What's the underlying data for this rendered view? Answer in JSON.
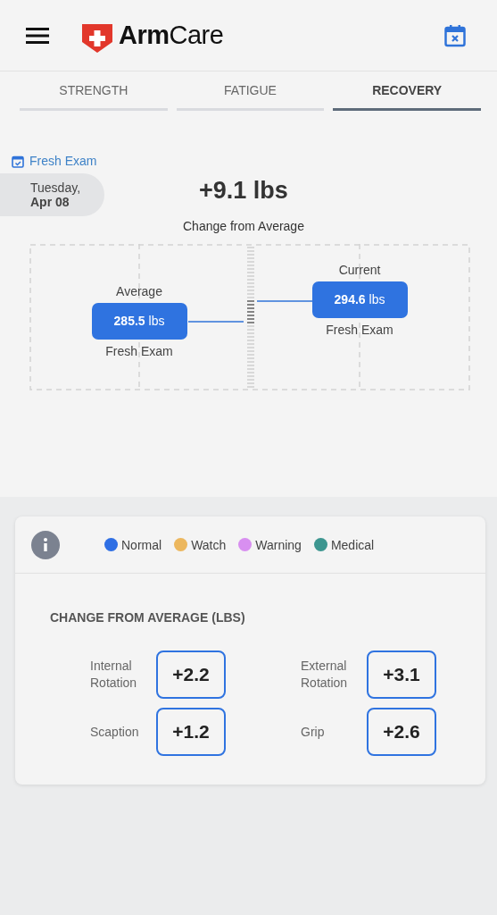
{
  "header": {
    "logo": "**Arm**Care"
  },
  "tabs": [
    {
      "label": "STRENGTH",
      "selected": false
    },
    {
      "label": "FATIGUE",
      "selected": false
    },
    {
      "label": "RECOVERY",
      "selected": true
    }
  ],
  "exam": {
    "type": "Fresh Exam",
    "day": "Tuesday,",
    "date": "Apr 08"
  },
  "change": {
    "value": "+9.1 lbs",
    "caption": "Change from Average"
  },
  "comparison": {
    "average": {
      "title": "Average",
      "value": "**285.5** lbs",
      "source": "Fresh Exam"
    },
    "current": {
      "title": "Current",
      "value": "**294.6** lbs",
      "source": "Fresh Exam"
    }
  },
  "legend": [
    {
      "label": "Normal",
      "color": "#2f6fe4"
    },
    {
      "label": "Watch",
      "color": "#ecb75e"
    },
    {
      "label": "Warning",
      "color": "#d88ff0"
    },
    {
      "label": "Medical",
      "color": "#3d9690"
    }
  ],
  "metrics_title": "CHANGE FROM AVERAGE (LBS)",
  "metrics": [
    {
      "label": "Internal Rotation",
      "value": "+2.2"
    },
    {
      "label": "External Rotation",
      "value": "+3.1"
    },
    {
      "label": "Scaption",
      "value": "+1.2"
    },
    {
      "label": "Grip",
      "value": "+2.6"
    }
  ]
}
